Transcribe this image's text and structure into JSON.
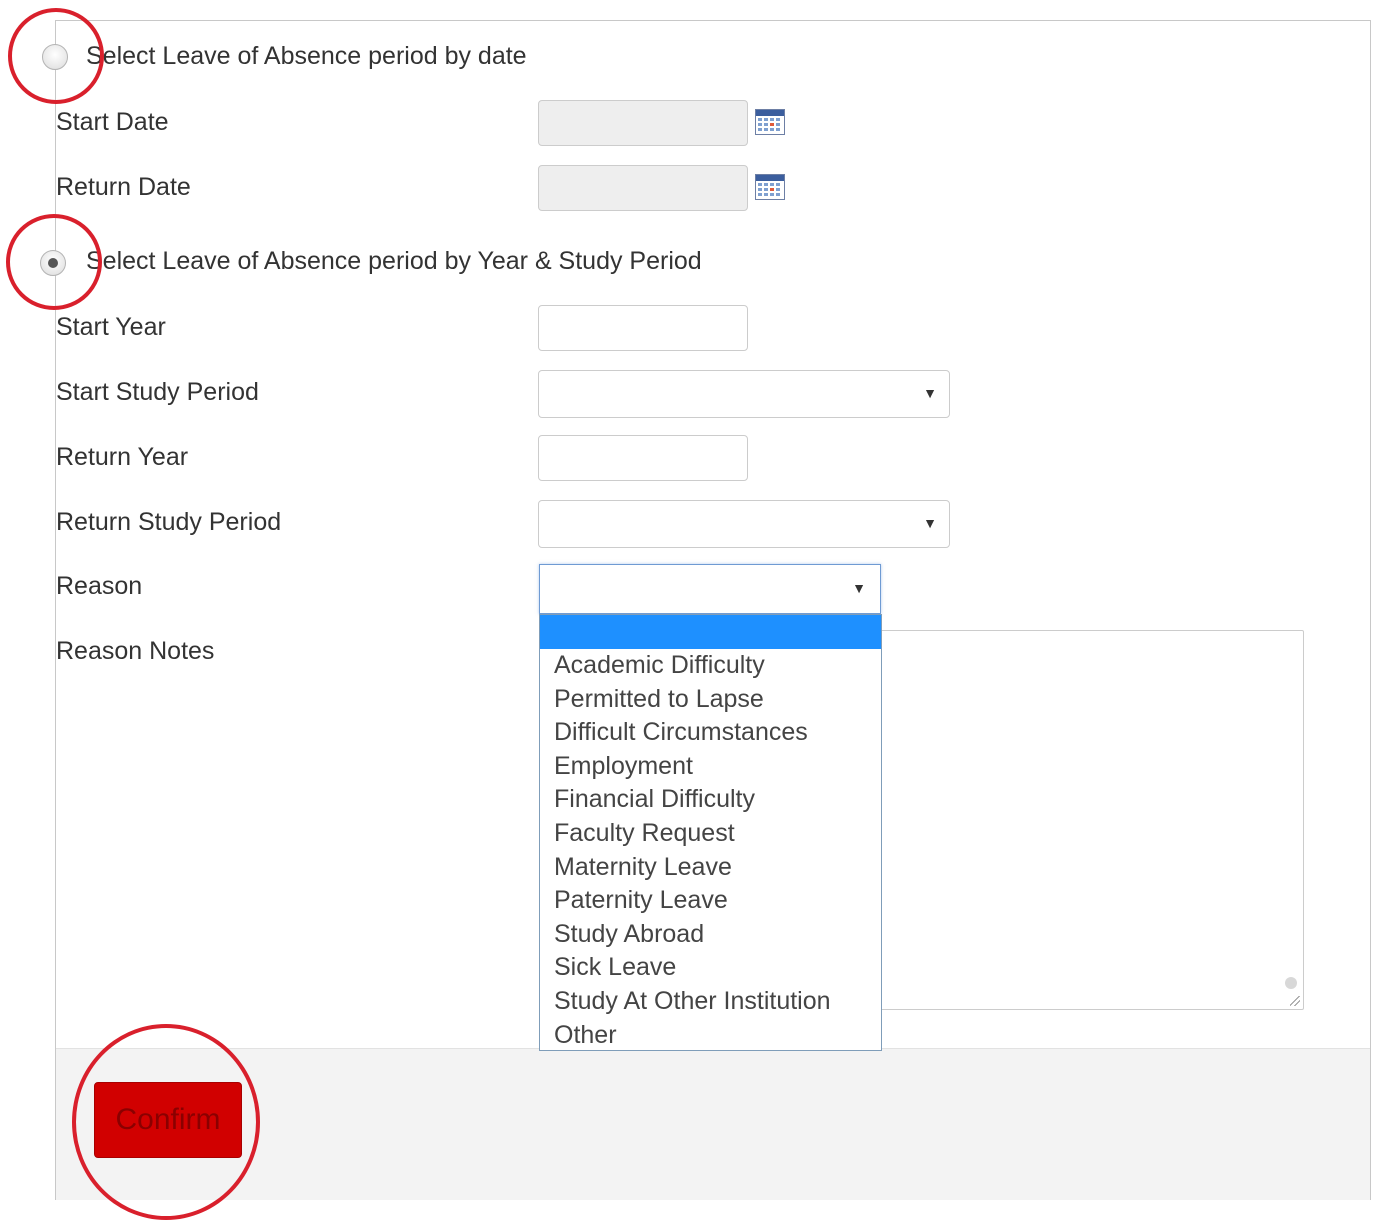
{
  "options": {
    "by_date_label": "Select Leave of Absence period by date",
    "by_year_label": "Select Leave of Absence period by Year & Study Period",
    "selected": "by_year"
  },
  "fields": {
    "start_date_label": "Start Date",
    "return_date_label": "Return Date",
    "start_year_label": "Start Year",
    "start_study_period_label": "Start Study Period",
    "return_year_label": "Return Year",
    "return_study_period_label": "Return Study Period",
    "reason_label": "Reason",
    "reason_notes_label": "Reason Notes"
  },
  "values": {
    "start_date": "",
    "return_date": "",
    "start_year": "",
    "start_study_period": "",
    "return_year": "",
    "return_study_period": "",
    "reason": ""
  },
  "reason_options": [
    "Academic Difficulty",
    "Permitted to Lapse",
    "Difficult Circumstances",
    "Employment",
    "Financial Difficulty",
    "Faculty Request",
    "Maternity Leave",
    "Paternity Leave",
    "Study Abroad",
    "Sick Leave",
    "Study At Other Institution",
    "Other"
  ],
  "actions": {
    "confirm_label": "Confirm"
  },
  "icons": {
    "calendar": "calendar-icon",
    "dropdown_arrow": "chevron-down-icon"
  },
  "colors": {
    "confirm_button": "#d10000",
    "highlight_option": "#1e90ff",
    "annotation_circle": "#d9202c"
  }
}
